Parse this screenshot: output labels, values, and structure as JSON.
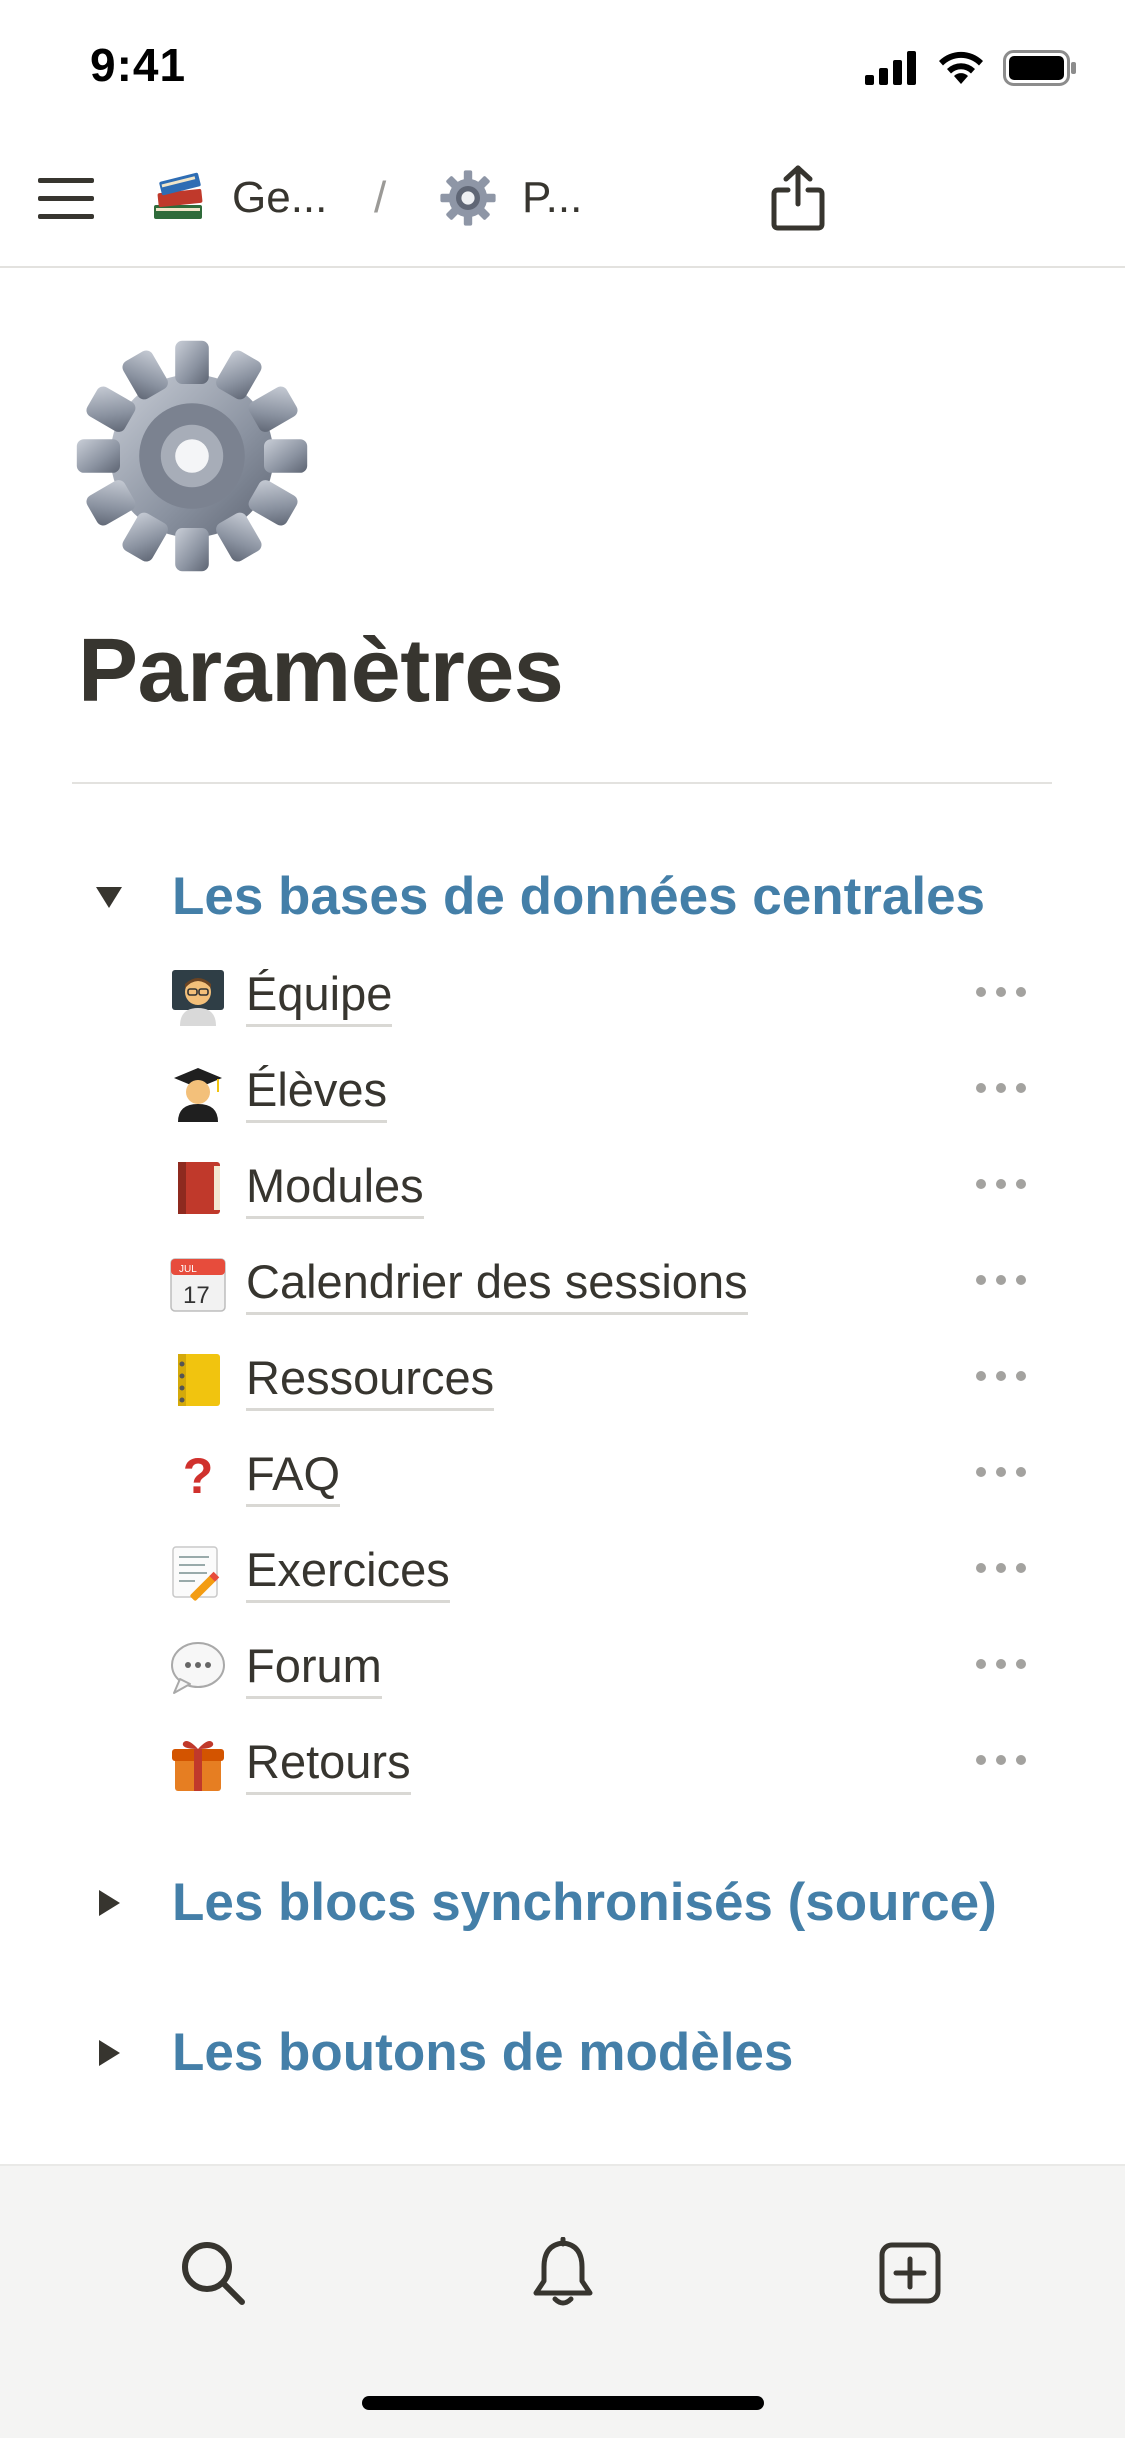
{
  "status_bar": {
    "time": "9:41"
  },
  "navbar": {
    "breadcrumb": [
      {
        "label": "Ge...",
        "icon": "books-icon"
      },
      {
        "label": "P...",
        "icon": "gear-icon"
      }
    ],
    "separator": "/"
  },
  "page": {
    "icon": "gear-icon",
    "title": "Paramètres"
  },
  "sections": [
    {
      "label": "Les bases de données centrales",
      "expanded": true,
      "items": [
        {
          "label": "Équipe",
          "icon": "teacher-icon"
        },
        {
          "label": "Élèves",
          "icon": "student-icon"
        },
        {
          "label": "Modules",
          "icon": "red-book-icon"
        },
        {
          "label": "Calendrier des sessions",
          "icon": "calendar-icon",
          "icon_month": "JUL",
          "icon_day": "17"
        },
        {
          "label": "Ressources",
          "icon": "notebook-icon"
        },
        {
          "label": "FAQ",
          "icon": "question-icon",
          "icon_text": "?"
        },
        {
          "label": "Exercices",
          "icon": "memo-icon"
        },
        {
          "label": "Forum",
          "icon": "speech-bubble-icon"
        },
        {
          "label": "Retours",
          "icon": "gift-icon"
        }
      ]
    },
    {
      "label": "Les blocs synchronisés (source)",
      "expanded": false
    },
    {
      "label": "Les boutons de modèles",
      "expanded": false
    }
  ],
  "colors": {
    "accent": "#447fa8",
    "text": "#37352f"
  }
}
